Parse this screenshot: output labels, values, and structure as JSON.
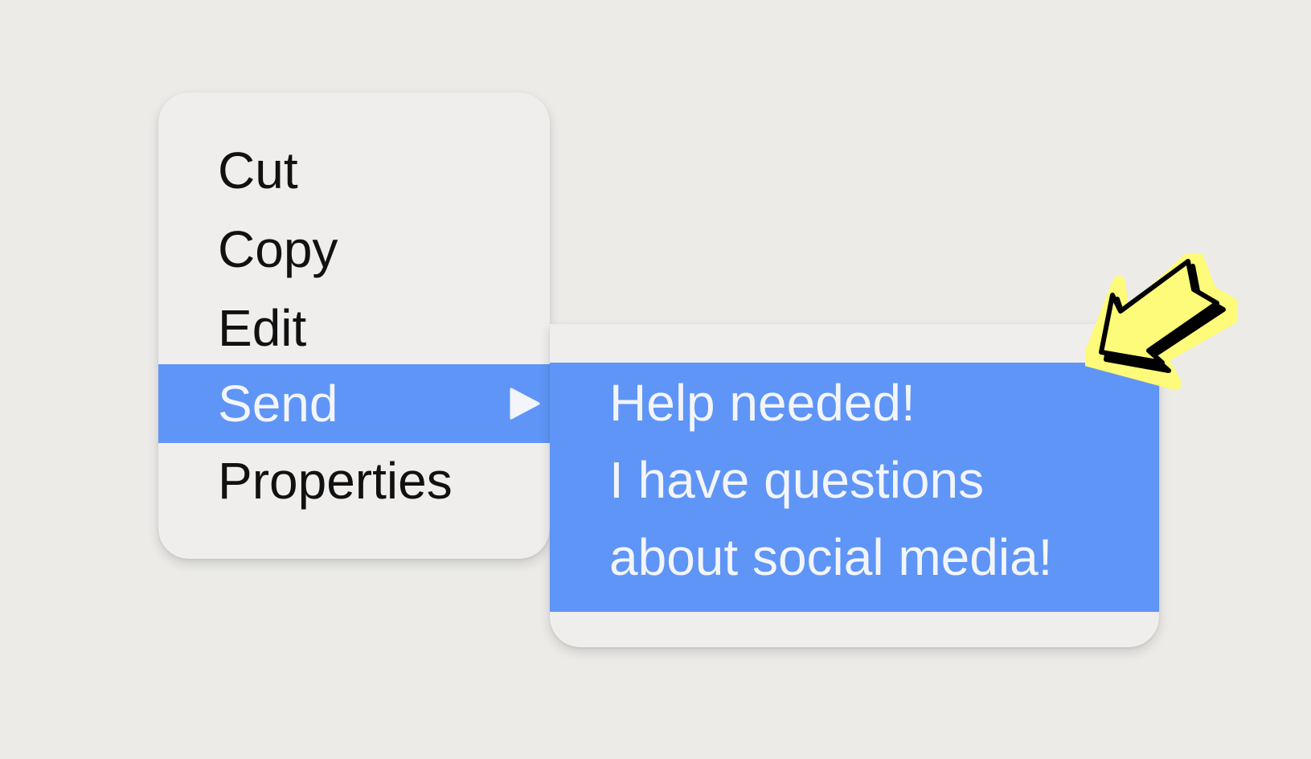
{
  "context_menu": {
    "items": [
      {
        "label": "Cut"
      },
      {
        "label": "Copy"
      },
      {
        "label": "Edit"
      },
      {
        "label": "Send",
        "highlighted": true,
        "has_submenu": true
      },
      {
        "label": "Properties"
      }
    ]
  },
  "submenu": {
    "lines": [
      "Help needed!",
      "I have questions",
      "about social media!"
    ]
  },
  "icons": {
    "submenu_indicator": "submenu-triangle-icon",
    "callout": "yellow-arrow-pointer-icon"
  },
  "colors": {
    "background": "#ecebe8",
    "menu_surface": "#f0eeec",
    "highlight": "#5f95f7",
    "highlight_text": "#f3f5fb",
    "text": "#111111",
    "callout_fill": "#fdfb79",
    "callout_outline": "#000000"
  }
}
